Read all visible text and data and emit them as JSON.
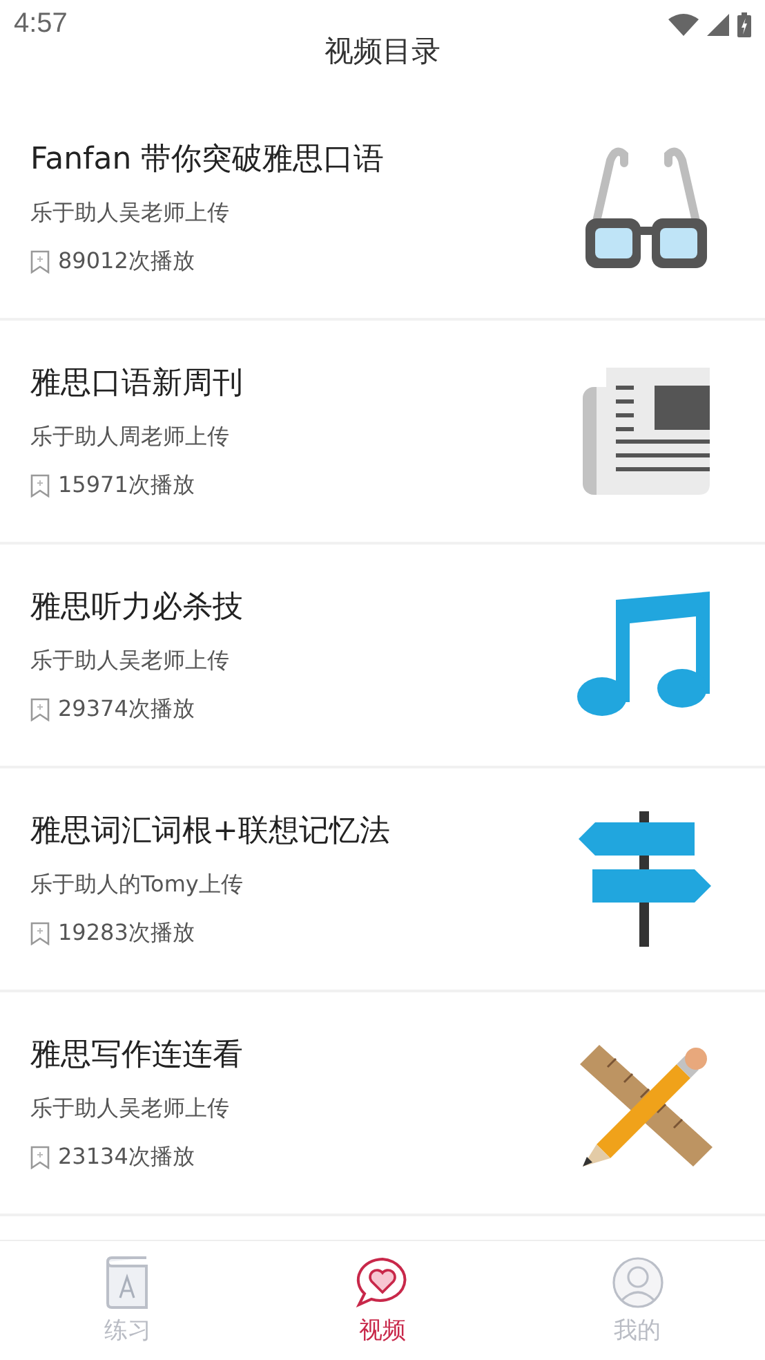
{
  "status_bar": {
    "time": "4:57"
  },
  "header": {
    "title": "视频目录"
  },
  "videos": [
    {
      "title": "Fanfan 带你突破雅思口语",
      "uploader": "乐于助人吴老师上传",
      "plays": "89012次播放",
      "kind": "glasses"
    },
    {
      "title": "雅思口语新周刊",
      "uploader": "乐于助人周老师上传",
      "plays": "15971次播放",
      "kind": "newspaper"
    },
    {
      "title": "雅思听力必杀技",
      "uploader": "乐于助人吴老师上传",
      "plays": "29374次播放",
      "kind": "music"
    },
    {
      "title": "雅思词汇词根+联想记忆法",
      "uploader": "乐于助人的Tomy上传",
      "plays": "19283次播放",
      "kind": "signpost"
    },
    {
      "title": "雅思写作连连看",
      "uploader": "乐于助人吴老师上传",
      "plays": "23134次播放",
      "kind": "tools"
    }
  ],
  "tabs": [
    {
      "label": "练习",
      "kind": "book",
      "selected": false
    },
    {
      "label": "视频",
      "kind": "heart",
      "selected": true
    },
    {
      "label": "我的",
      "kind": "person",
      "selected": false
    }
  ]
}
